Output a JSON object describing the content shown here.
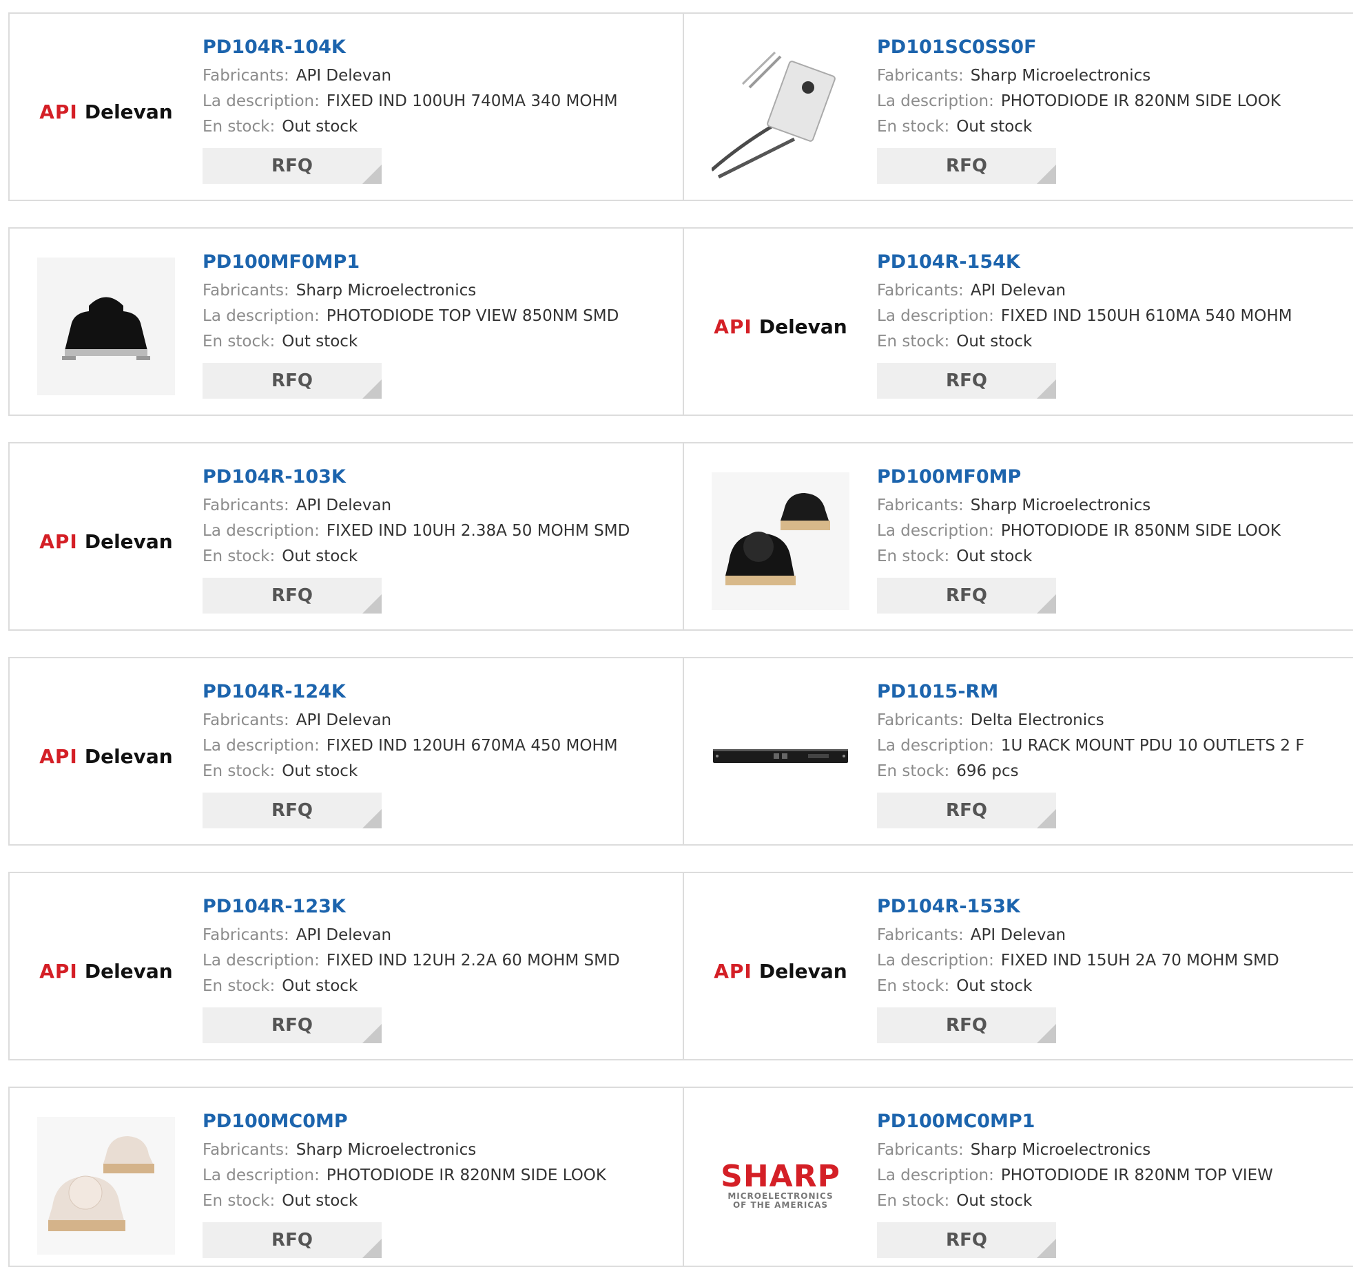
{
  "labels": {
    "manufacturer": "Fabricants:",
    "description": "La description:",
    "stock": "En stock:",
    "rfq": "RFQ"
  },
  "logos": {
    "api_delevan": {
      "part1": "API",
      "part2": "Delevan"
    },
    "sharp": {
      "name": "SHARP",
      "line1": "MICROELECTRONICS",
      "line2": "OF THE AMERICAS"
    }
  },
  "products": [
    {
      "pn": "PD104R-104K",
      "manufacturer": "API Delevan",
      "description": "FIXED IND 100UH 740MA 340 MOHM",
      "stock": "Out stock",
      "image": "api-delevan-logo"
    },
    {
      "pn": "PD101SC0SS0F",
      "manufacturer": "Sharp Microelectronics",
      "description": "PHOTODIODE IR 820NM SIDE LOOK",
      "stock": "Out stock",
      "image": "photodiode-leaded-photo"
    },
    {
      "pn": "PD100MF0MP1",
      "manufacturer": "Sharp Microelectronics",
      "description": "PHOTODIODE TOP VIEW 850NM SMD",
      "stock": "Out stock",
      "image": "black-smd-photodiode-photo"
    },
    {
      "pn": "PD104R-154K",
      "manufacturer": "API Delevan",
      "description": "FIXED IND 150UH 610MA 540 MOHM",
      "stock": "Out stock",
      "image": "api-delevan-logo"
    },
    {
      "pn": "PD104R-103K",
      "manufacturer": "API Delevan",
      "description": "FIXED IND 10UH 2.38A 50 MOHM SMD",
      "stock": "Out stock",
      "image": "api-delevan-logo"
    },
    {
      "pn": "PD100MF0MP",
      "manufacturer": "Sharp Microelectronics",
      "description": "PHOTODIODE IR 850NM SIDE LOOK",
      "stock": "Out stock",
      "image": "two-black-smd-photodiodes-photo"
    },
    {
      "pn": "PD104R-124K",
      "manufacturer": "API Delevan",
      "description": "FIXED IND 120UH 670MA 450 MOHM",
      "stock": "Out stock",
      "image": "api-delevan-logo"
    },
    {
      "pn": "PD1015-RM",
      "manufacturer": "Delta Electronics",
      "description": "1U RACK MOUNT PDU 10 OUTLETS 2 F",
      "stock": "696 pcs",
      "image": "rack-pdu-photo"
    },
    {
      "pn": "PD104R-123K",
      "manufacturer": "API Delevan",
      "description": "FIXED IND 12UH 2.2A 60 MOHM SMD",
      "stock": "Out stock",
      "image": "api-delevan-logo"
    },
    {
      "pn": "PD104R-153K",
      "manufacturer": "API Delevan",
      "description": "FIXED IND 15UH 2A 70 MOHM SMD",
      "stock": "Out stock",
      "image": "api-delevan-logo"
    },
    {
      "pn": "PD100MC0MP",
      "manufacturer": "Sharp Microelectronics",
      "description": "PHOTODIODE IR 820NM SIDE LOOK",
      "stock": "Out stock",
      "image": "two-clear-smd-photodiodes-photo"
    },
    {
      "pn": "PD100MC0MP1",
      "manufacturer": "Sharp Microelectronics",
      "description": "PHOTODIODE IR 820NM TOP VIEW",
      "stock": "Out stock",
      "image": "sharp-logo"
    }
  ]
}
